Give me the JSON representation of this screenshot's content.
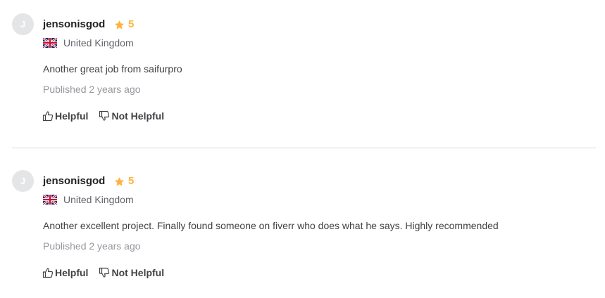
{
  "reviews": [
    {
      "avatar_letter": "J",
      "username": "jensonisgod",
      "rating": "5",
      "country": "United Kingdom",
      "text": "Another great job from saifurpro",
      "published": "Published 2 years ago",
      "helpful_label": "Helpful",
      "not_helpful_label": "Not Helpful"
    },
    {
      "avatar_letter": "J",
      "username": "jensonisgod",
      "rating": "5",
      "country": "United Kingdom",
      "text": "Another excellent project. Finally found someone on fiverr who does what he says. Highly recommended",
      "published": "Published 2 years ago",
      "helpful_label": "Helpful",
      "not_helpful_label": "Not Helpful"
    }
  ],
  "colors": {
    "star": "#ffb33e",
    "avatar_bg": "#e4e5e7",
    "muted_text": "#95979d",
    "divider": "#dadbdd"
  },
  "icons": {
    "rating": "star-icon",
    "country": "uk-flag-icon",
    "helpful": "thumbs-up-icon",
    "not_helpful": "thumbs-down-icon"
  }
}
